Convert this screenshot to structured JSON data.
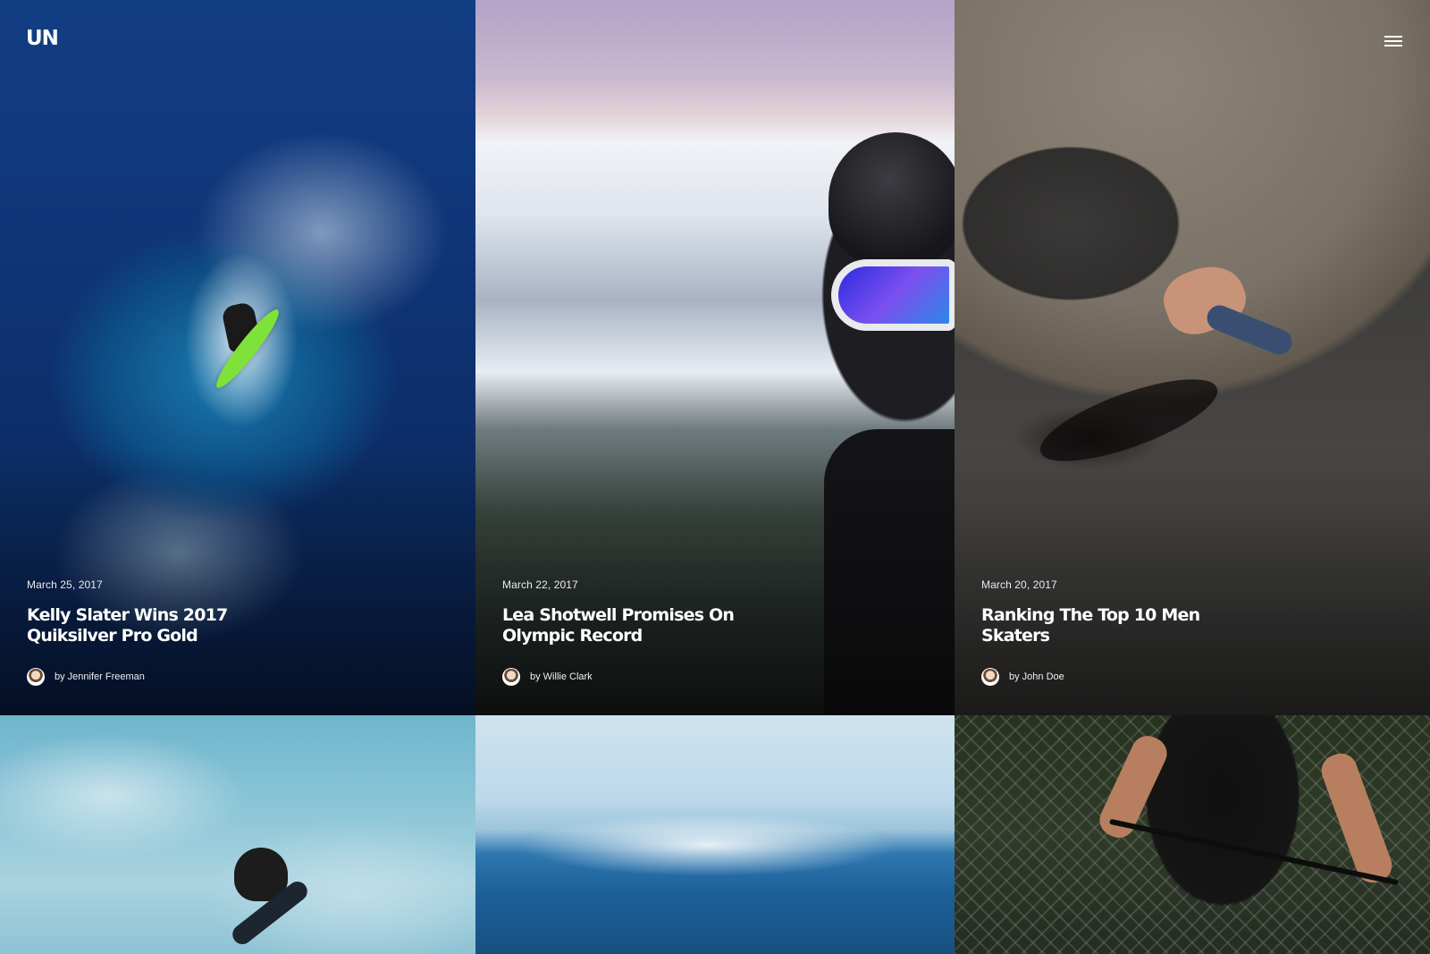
{
  "header": {
    "logo": "UN",
    "menu_icon": "hamburger-menu-icon"
  },
  "articles": [
    {
      "date": "March 25, 2017",
      "title": "Kelly Slater Wins 2017 Quiksilver Pro Gold",
      "author": "by Jennifer Freeman",
      "image": "surfer-on-wave"
    },
    {
      "date": "March 22, 2017",
      "title": "Lea Shotwell Promises On Olympic Record",
      "author": "by Willie Clark",
      "image": "skier-with-goggles"
    },
    {
      "date": "March 20, 2017",
      "title": "Ranking The Top 10 Men Skaters",
      "author": "by John Doe",
      "image": "skater-in-bowl"
    }
  ],
  "more_tiles": [
    {
      "image": "snowboarder-jump"
    },
    {
      "image": "ocean-wave"
    },
    {
      "image": "bmx-rider"
    }
  ],
  "colors": {
    "text": "#ffffff",
    "ocean": "#0f3578",
    "sky": "#8cc6d7"
  }
}
